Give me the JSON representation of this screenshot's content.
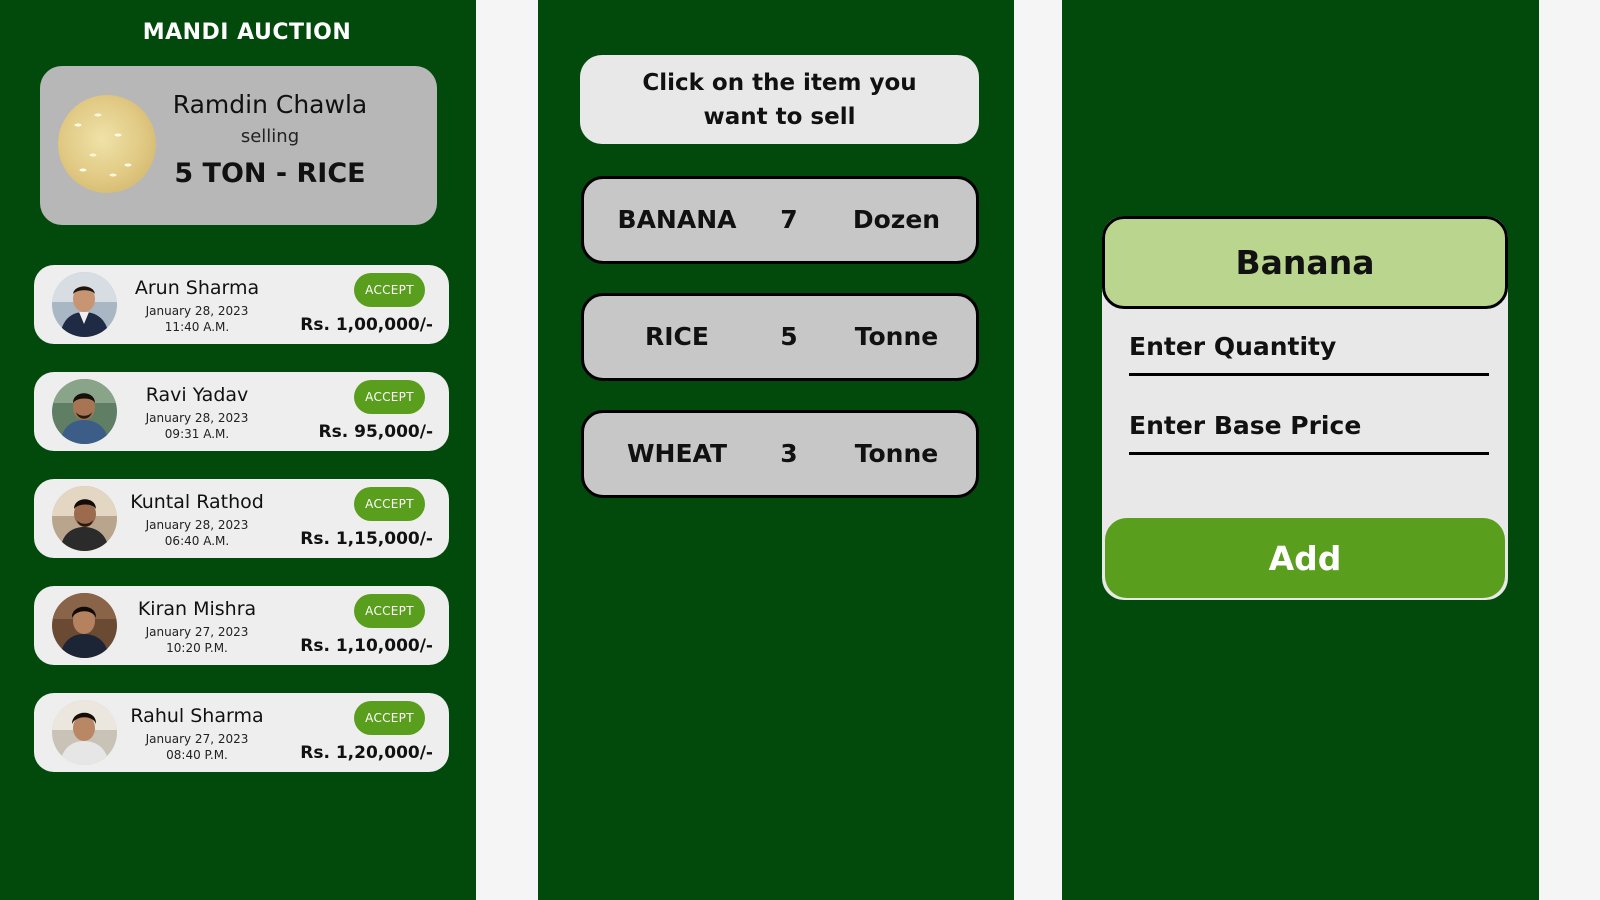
{
  "app_title": "MANDI AUCTION",
  "seller": {
    "name": "Ramdin Chawla",
    "selling_label": "selling",
    "product": "5 TON - RICE",
    "image_icon": "rice-grains-image"
  },
  "bids": [
    {
      "name": "Arun Sharma",
      "date": "January 28, 2023",
      "time": "11:40 A.M.",
      "amount": "Rs. 1,00,000/-",
      "accept_label": "ACCEPT"
    },
    {
      "name": "Ravi Yadav",
      "date": "January 28, 2023",
      "time": "09:31 A.M.",
      "amount": "Rs. 95,000/-",
      "accept_label": "ACCEPT"
    },
    {
      "name": "Kuntal Rathod",
      "date": "January 28, 2023",
      "time": "06:40 A.M.",
      "amount": "Rs. 1,15,000/-",
      "accept_label": "ACCEPT"
    },
    {
      "name": "Kiran Mishra",
      "date": "January 27, 2023",
      "time": "10:20 P.M.",
      "amount": "Rs. 1,10,000/-",
      "accept_label": "ACCEPT"
    },
    {
      "name": "Rahul Sharma",
      "date": "January 27, 2023",
      "time": "08:40 P.M.",
      "amount": "Rs. 1,20,000/-",
      "accept_label": "ACCEPT"
    }
  ],
  "sell_screen": {
    "instruction": "Click on the item you want to sell",
    "items": [
      {
        "name": "BANANA",
        "quantity": "7",
        "unit": "Dozen"
      },
      {
        "name": "RICE",
        "quantity": "5",
        "unit": "Tonne"
      },
      {
        "name": "WHEAT",
        "quantity": "3",
        "unit": "Tonne"
      }
    ]
  },
  "add_form": {
    "item_title": "Banana",
    "quantity_placeholder": "Enter Quantity",
    "base_price_placeholder": "Enter Base Price",
    "add_label": "Add"
  },
  "colors": {
    "panel_green": "#024a0c",
    "accent_green": "#5a9e1d",
    "light_green_header": "#b9d58e",
    "card_gray": "#b7b7b7",
    "item_gray": "#c7c7c7",
    "card_light": "#eeeeee"
  }
}
